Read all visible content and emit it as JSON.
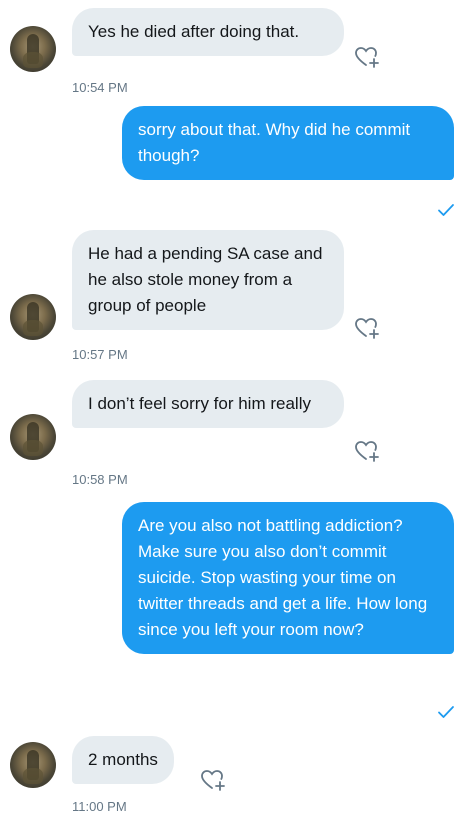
{
  "messages": [
    {
      "side": "in",
      "text": "Yes he died after doing that.",
      "time": "10:54 PM"
    },
    {
      "side": "out",
      "text": "sorry about that. Why did he commit though?",
      "read": true
    },
    {
      "side": "in",
      "text": "He had a pending SA case and he also stole money from a group of people",
      "time": "10:57 PM"
    },
    {
      "side": "in",
      "text": "I don’t feel sorry for him really",
      "time": "10:58 PM"
    },
    {
      "side": "out",
      "text": "Are you also not battling addiction? Make sure you also don’t commit suicide. Stop wasting your time on twitter threads and get a life. How long since you left your room now?",
      "read": true
    },
    {
      "side": "in",
      "text": "2 months",
      "time": "11:00 PM"
    }
  ],
  "colors": {
    "outgoing_bubble": "#1d9bf0",
    "incoming_bubble": "#e6ecf0",
    "timestamp": "#657786",
    "read_check": "#1d9bf0"
  },
  "icons": {
    "like": "heart-plus-icon",
    "read": "checkmark-icon",
    "avatar": "user-avatar"
  }
}
